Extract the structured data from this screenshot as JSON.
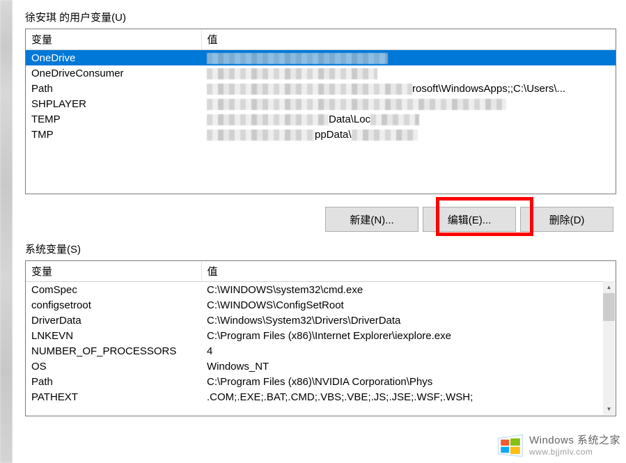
{
  "user_section": {
    "label": "徐安琪 的用户变量(U)",
    "col_var": "变量",
    "col_val": "值",
    "rows": [
      {
        "name": "OneDrive",
        "value": "",
        "selected": true,
        "blurred": true,
        "blur_width": 260
      },
      {
        "name": "OneDriveConsumer",
        "value": "",
        "blurred": true,
        "blur_width": 245
      },
      {
        "name": "Path",
        "value": "rosoft\\WindowsApps;;C:\\Users\\...",
        "blurred_prefix": true,
        "blur_width": 295
      },
      {
        "name": "SHPLAYER",
        "value": "",
        "blurred": true,
        "blur_width": 430
      },
      {
        "name": "TEMP",
        "value_parts": [
          {
            "blur_w": 175
          },
          {
            "text": "Data\\Loc"
          },
          {
            "blur_w": 70
          }
        ]
      },
      {
        "name": "TMP",
        "value_parts": [
          {
            "blur_w": 155
          },
          {
            "text": "ppData\\"
          },
          {
            "blur_w": 95
          }
        ]
      }
    ],
    "buttons": {
      "new": "新建(N)...",
      "edit": "编辑(E)...",
      "delete": "删除(D)"
    }
  },
  "sys_section": {
    "label": "系统变量(S)",
    "col_var": "变量",
    "col_val": "值",
    "rows": [
      {
        "name": "ComSpec",
        "value": "C:\\WINDOWS\\system32\\cmd.exe"
      },
      {
        "name": "configsetroot",
        "value": "C:\\WINDOWS\\ConfigSetRoot"
      },
      {
        "name": "DriverData",
        "value": "C:\\Windows\\System32\\Drivers\\DriverData"
      },
      {
        "name": "LNKEVN",
        "value": "C:\\Program Files (x86)\\Internet Explorer\\iexplore.exe"
      },
      {
        "name": "NUMBER_OF_PROCESSORS",
        "value": "4"
      },
      {
        "name": "OS",
        "value": "Windows_NT"
      },
      {
        "name": "Path",
        "value": "C:\\Program Files (x86)\\NVIDIA Corporation\\Phys"
      },
      {
        "name": "PATHEXT",
        "value": ".COM;.EXE;.BAT;.CMD;.VBS;.VBE;.JS;.JSE;.WSF;.WSH;"
      }
    ]
  },
  "watermark": {
    "line1": "Windows 系统之家",
    "line2": "www.bjjmlv.com"
  }
}
